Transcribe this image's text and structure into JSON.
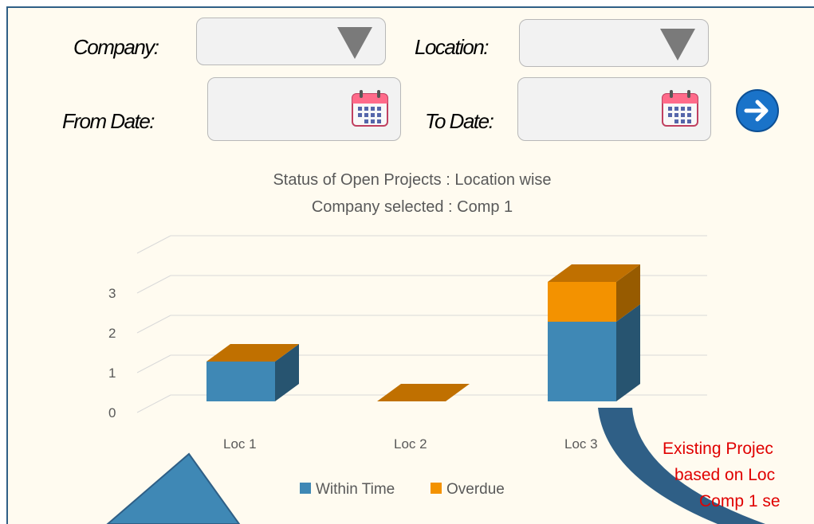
{
  "filters": {
    "company_label": "Company:",
    "location_label": "Location:",
    "from_date_label": "From Date:",
    "to_date_label": "To Date:",
    "company_value": "",
    "location_value": ""
  },
  "chart_data": {
    "type": "bar",
    "stacked": true,
    "three_d": true,
    "title": "Status of Open Projects : Location wise",
    "subtitle": "Company selected : Comp 1",
    "categories": [
      "Loc 1",
      "Loc 2",
      "Loc 3"
    ],
    "series": [
      {
        "name": "Within Time",
        "values": [
          1,
          0,
          2
        ],
        "color": "#3f88b5"
      },
      {
        "name": "Overdue",
        "values": [
          0,
          0,
          1
        ],
        "color": "#f39200"
      }
    ],
    "yticks": [
      0,
      1,
      2,
      3
    ],
    "ylim": [
      0,
      3.5
    ],
    "legend_position": "bottom",
    "grid": true
  },
  "annotation": {
    "lines": [
      "Existing Projec",
      "based on Loc",
      "Comp 1 se"
    ]
  },
  "colors": {
    "accent": "#2f5f86",
    "bar_top": "#c07000",
    "arrow": "#2f5f86"
  }
}
